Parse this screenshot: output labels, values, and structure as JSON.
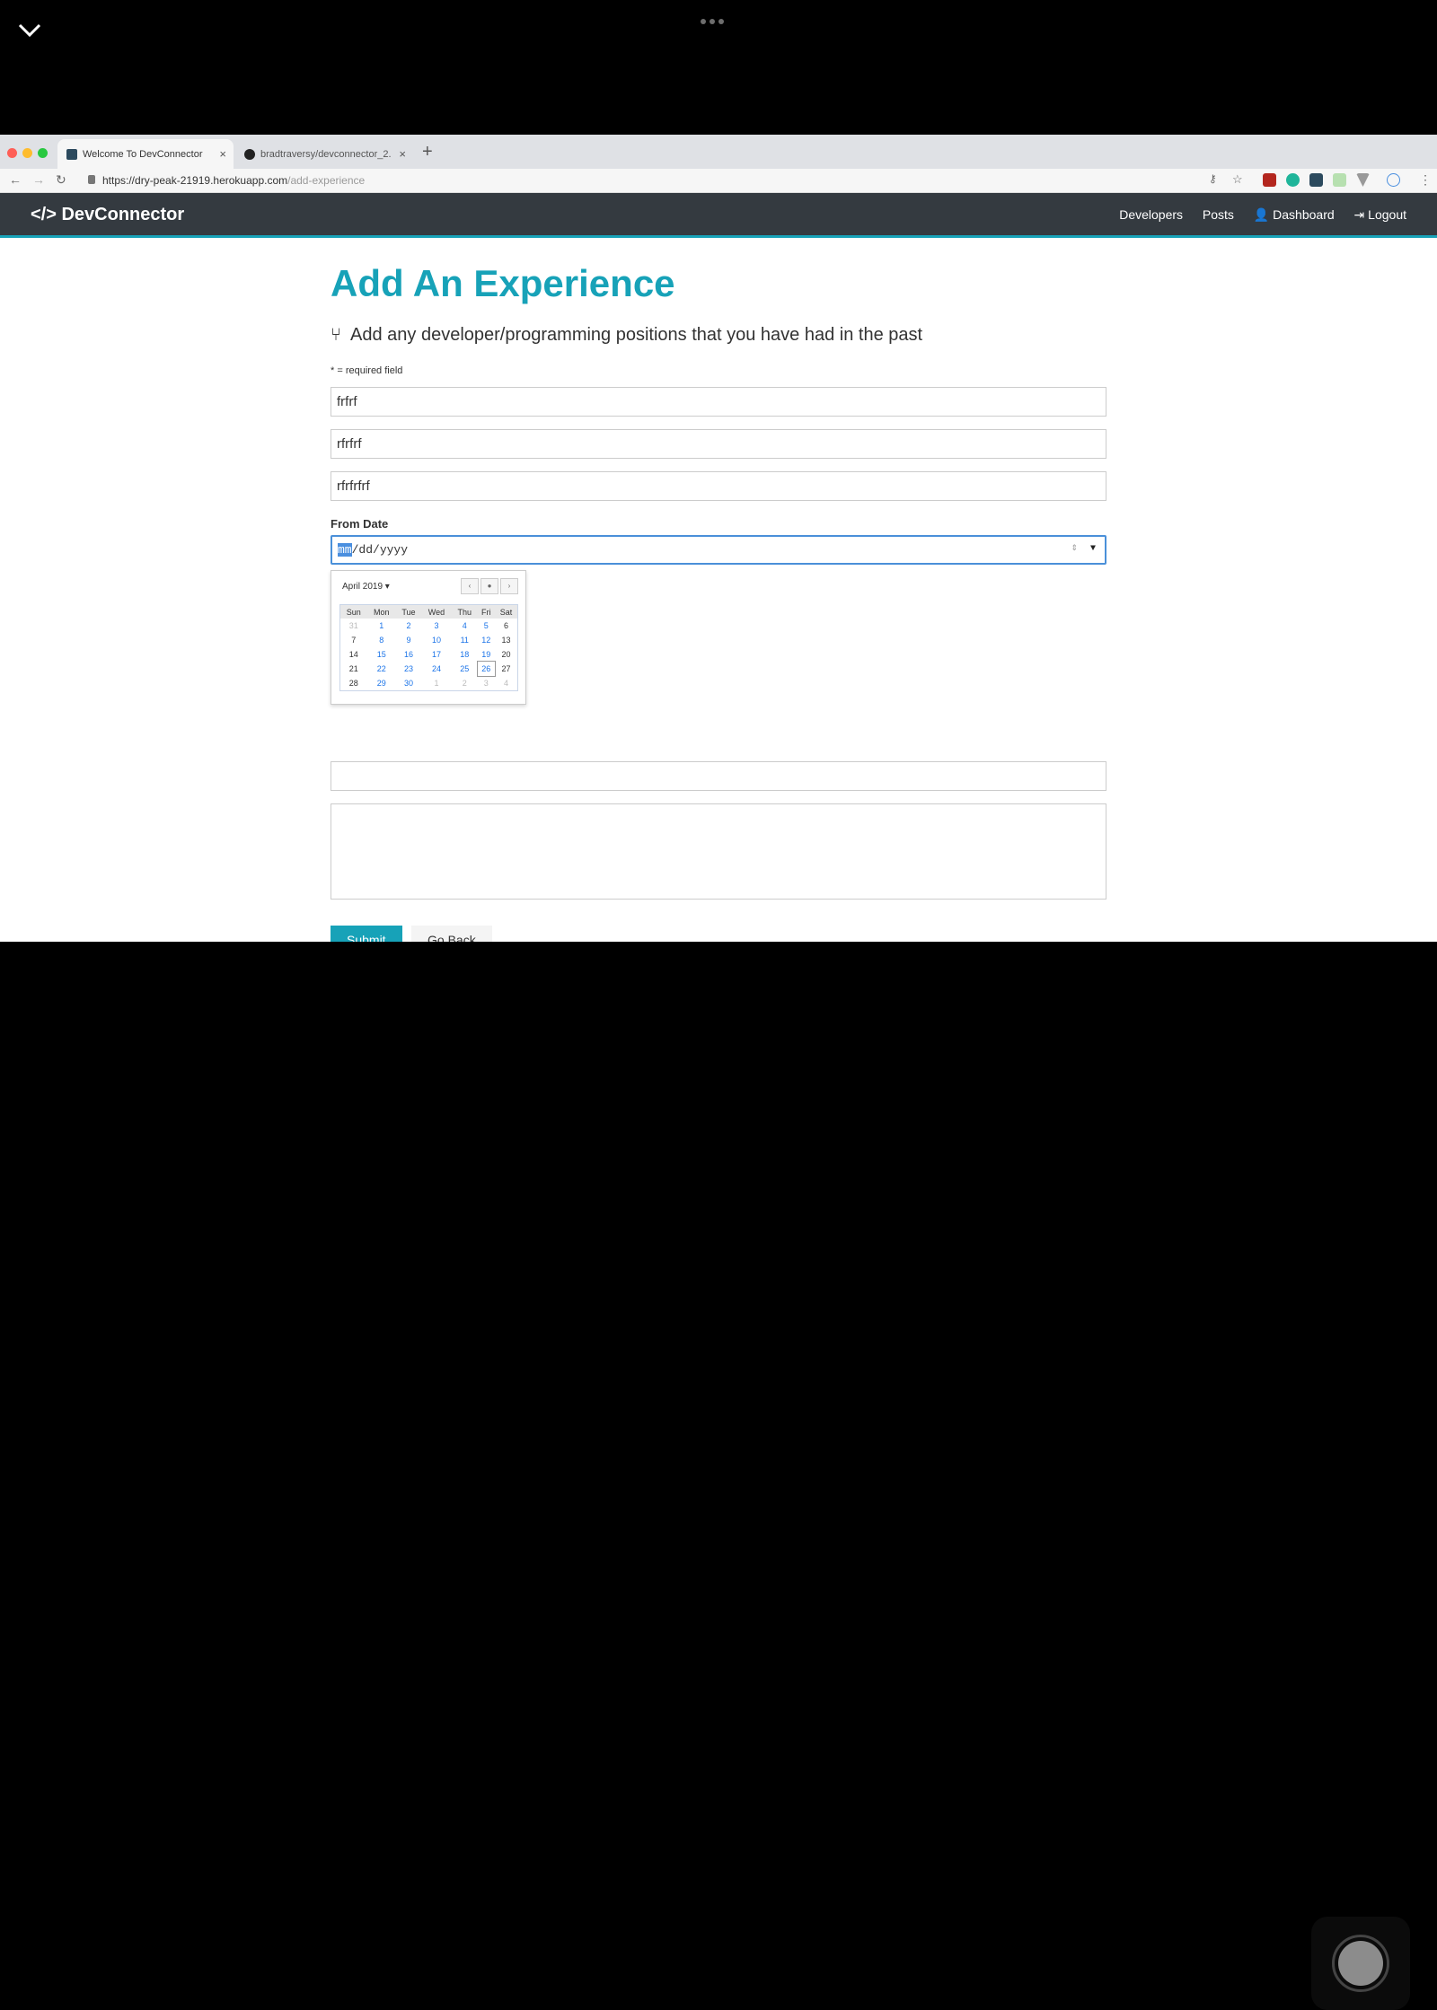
{
  "browser": {
    "tabs": [
      {
        "title": "Welcome To DevConnector",
        "active": true
      },
      {
        "title": "bradtraversy/devconnector_2.",
        "active": false
      }
    ],
    "url_host": "https://dry-peak-21919.herokuapp.com",
    "url_path": "/add-experience"
  },
  "navbar": {
    "brand": "</> DevConnector",
    "links": [
      "Developers",
      "Posts",
      "Dashboard",
      "Logout"
    ]
  },
  "page": {
    "title": "Add An Experience",
    "lead": "Add any developer/programming positions that you have had in the past",
    "required_note": "* = required field",
    "fields": {
      "title_value": "frfrf",
      "company_value": "rfrfrf",
      "location_value": "rfrfrfrf"
    },
    "from_date_label": "From Date",
    "from_date_mm": "mm",
    "from_date_rest": "/dd/yyyy",
    "submit_label": "Submit",
    "back_label": "Go Back"
  },
  "calendar": {
    "month_label": "April 2019 ▾",
    "nav": [
      "‹",
      "●",
      "›"
    ],
    "weekdays": [
      "Sun",
      "Mon",
      "Tue",
      "Wed",
      "Thu",
      "Fri",
      "Sat"
    ],
    "weeks": [
      [
        "31",
        "1",
        "2",
        "3",
        "4",
        "5",
        "6"
      ],
      [
        "7",
        "8",
        "9",
        "10",
        "11",
        "12",
        "13"
      ],
      [
        "14",
        "15",
        "16",
        "17",
        "18",
        "19",
        "20"
      ],
      [
        "21",
        "22",
        "23",
        "24",
        "25",
        "26",
        "27"
      ],
      [
        "28",
        "29",
        "30",
        "1",
        "2",
        "3",
        "4"
      ]
    ],
    "today": "26",
    "colors": {
      "selected_field_border": "#4a90d9",
      "accent": "#17a2b8"
    }
  }
}
